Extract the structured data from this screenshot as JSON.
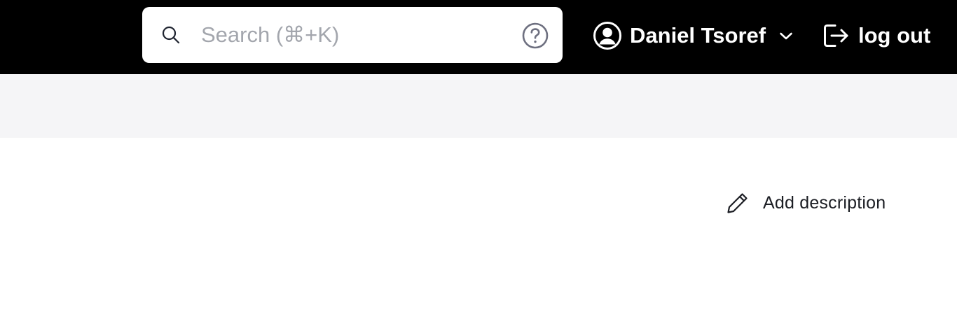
{
  "header": {
    "search": {
      "placeholder": "Search (⌘+K)",
      "value": ""
    },
    "user": {
      "name": "Daniel Tsoref"
    },
    "logout_label": "log out"
  },
  "main": {
    "add_description_label": "Add description"
  },
  "colors": {
    "topbar_bg": "#000000",
    "subheader_bg": "#f5f5f7",
    "placeholder": "#a3a6ad",
    "help_icon": "#6e7080"
  },
  "icons": {
    "search": "search-icon",
    "help": "question-circle-icon",
    "user": "user-circle-icon",
    "chevron": "chevron-down-icon",
    "logout": "logout-icon",
    "pencil": "pencil-icon"
  }
}
